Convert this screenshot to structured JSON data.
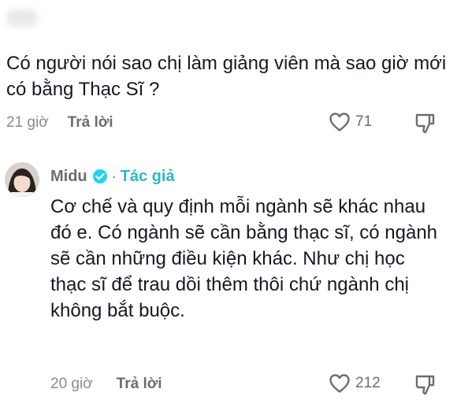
{
  "comment1": {
    "text": "Có người nói sao chị làm giảng viên mà sao giờ mới có bằng Thạc Sĩ ?",
    "time": "21 giờ",
    "reply_label": "Trả lời",
    "likes": "71"
  },
  "comment2": {
    "author": "Midu",
    "author_tag": "Tác giả",
    "separator": "·",
    "text": "Cơ chế và quy định mỗi ngành sẽ khác nhau đó e. Có ngành sẽ cần bằng thạc sĩ, có ngành sẽ cần những điều kiện khác. Như chị học thạc sĩ để trau dồi thêm thôi chứ ngành chị không bắt buộc.",
    "time": "20 giờ",
    "reply_label": "Trả lời",
    "likes": "212"
  },
  "icons": {
    "like": "heart-outline-icon",
    "dislike": "thumbs-down-icon",
    "verified": "verified-check-icon"
  },
  "colors": {
    "text": "#161823",
    "meta": "#8a8b91",
    "author_tag": "#2fb4d0",
    "verified": "#20d5ec"
  }
}
